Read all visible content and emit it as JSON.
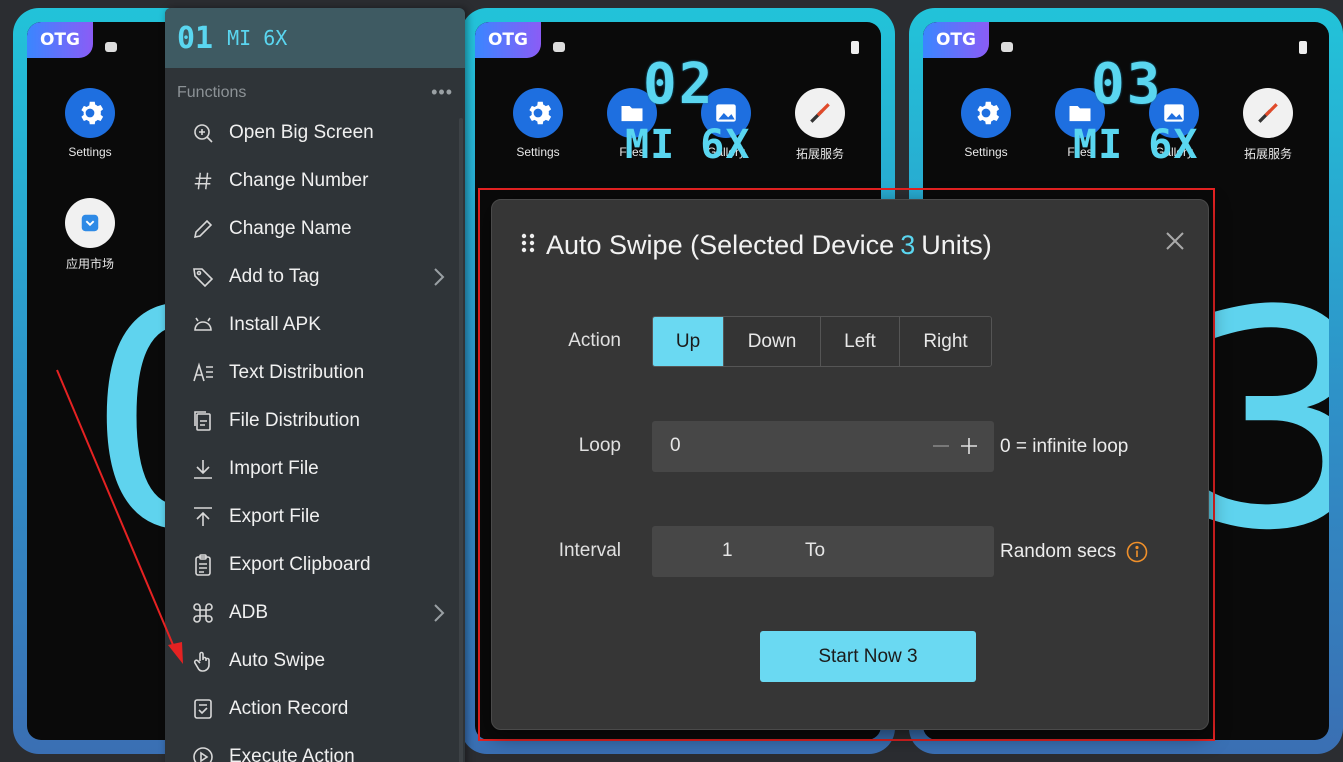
{
  "devices": [
    {
      "otg": "OTG",
      "number": "01",
      "name": "MI 6X",
      "huge_digit": "0",
      "apps": [
        {
          "label": "Settings",
          "icon": "gear-icon"
        },
        {
          "label": "应用市场",
          "icon": "app-store-icon"
        }
      ]
    },
    {
      "otg": "OTG",
      "number": "02",
      "name": "MI 6X",
      "apps": [
        {
          "label": "Settings",
          "icon": "gear-icon"
        },
        {
          "label": "Files",
          "icon": "folder-icon"
        },
        {
          "label": "Gallery",
          "icon": "gallery-icon"
        },
        {
          "label": "拓展服务",
          "icon": "tools-icon"
        }
      ]
    },
    {
      "otg": "OTG",
      "number": "03",
      "name": "MI 6X",
      "huge_digit": "3",
      "apps": [
        {
          "label": "Settings",
          "icon": "gear-icon"
        },
        {
          "label": "Files",
          "icon": "folder-icon"
        },
        {
          "label": "Gallery",
          "icon": "gallery-icon"
        },
        {
          "label": "拓展服务",
          "icon": "tools-icon"
        }
      ]
    }
  ],
  "menu": {
    "device_number": "01",
    "device_name": "MI 6X",
    "section": "Functions",
    "more": "•••",
    "items": [
      {
        "label": "Open Big Screen",
        "icon": "zoom-in-icon"
      },
      {
        "label": "Change Number",
        "icon": "hash-icon"
      },
      {
        "label": "Change Name",
        "icon": "pencil-icon"
      },
      {
        "label": "Add to Tag",
        "icon": "tag-icon",
        "submenu": true
      },
      {
        "label": "Install APK",
        "icon": "android-icon"
      },
      {
        "label": "Text Distribution",
        "icon": "text-icon"
      },
      {
        "label": "File Distribution",
        "icon": "file-copy-icon"
      },
      {
        "label": "Import File",
        "icon": "download-icon"
      },
      {
        "label": "Export File",
        "icon": "upload-icon"
      },
      {
        "label": "Export Clipboard",
        "icon": "clipboard-icon"
      },
      {
        "label": "ADB",
        "icon": "command-icon",
        "submenu": true
      },
      {
        "label": "Auto Swipe",
        "icon": "swipe-hand-icon"
      },
      {
        "label": "Action Record",
        "icon": "record-icon"
      },
      {
        "label": "Execute Action",
        "icon": "play-icon"
      }
    ]
  },
  "modal": {
    "title_prefix": "Auto Swipe (Selected Device",
    "title_count": "3",
    "title_suffix": "Units)",
    "action_label": "Action",
    "actions": [
      "Up",
      "Down",
      "Left",
      "Right"
    ],
    "active_action": "Up",
    "loop_label": "Loop",
    "loop_value": "0",
    "loop_hint": "0 = infinite loop",
    "interval_label": "Interval",
    "interval_from": "1",
    "interval_to_label": "To",
    "interval_to": "",
    "interval_hint": "Random secs",
    "start_button": "Start Now 3"
  },
  "colors": {
    "accent": "#6ad9f2",
    "highlight": "#5ad6f0",
    "annotation": "#e52222",
    "info": "#f0902a"
  }
}
